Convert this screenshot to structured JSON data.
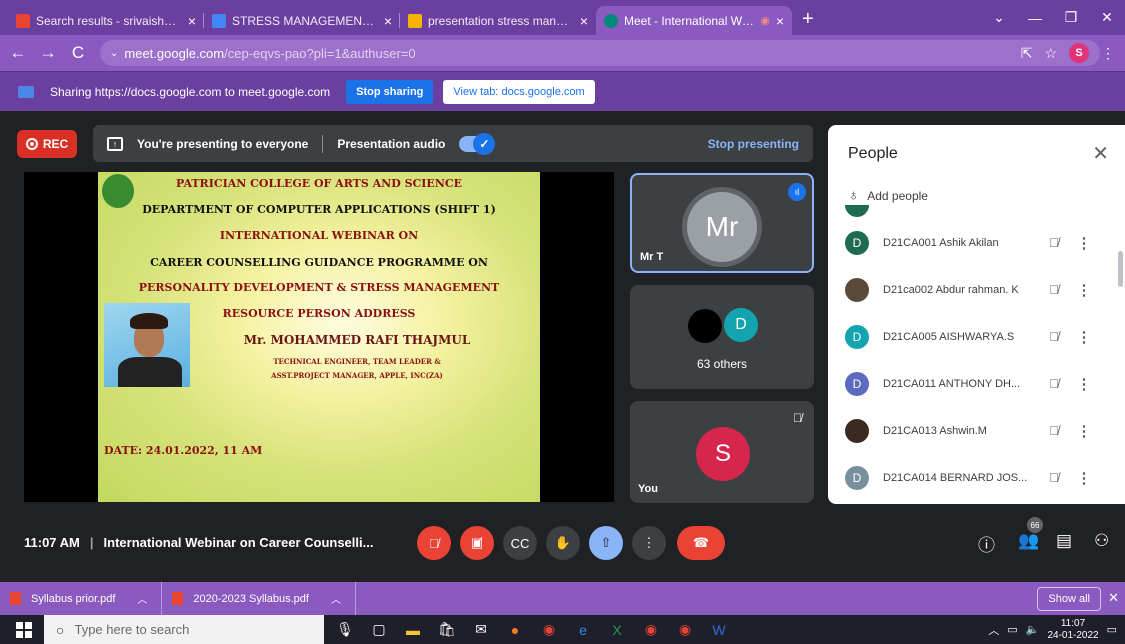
{
  "browser": {
    "tabs": [
      {
        "title": "Search results - srivaishnavi@pat",
        "icon": "gmail-icon",
        "color": "#ea4335"
      },
      {
        "title": "STRESS MANAGEMENT REPORT",
        "icon": "docs-icon",
        "color": "#4285f4"
      },
      {
        "title": "presentation stress mangem",
        "icon": "slides-icon",
        "color": "#f4b400"
      },
      {
        "title": "Meet - International Webina",
        "icon": "meet-icon",
        "color": "#00897b"
      }
    ],
    "url_host": "meet.google.com",
    "url_path": "/cep-eqvs-pao?pli=1&authuser=0",
    "profile_initial": "S"
  },
  "sharing": {
    "text": "Sharing https://docs.google.com to meet.google.com",
    "stop_label": "Stop sharing",
    "view_label": "View tab: docs.google.com"
  },
  "meet": {
    "rec_label": "REC",
    "presenting_text": "You're presenting to everyone",
    "audio_label": "Presentation audio",
    "stop_presenting": "Stop presenting",
    "slide": {
      "college": "PATRICIAN COLLEGE OF ARTS AND SCIENCE",
      "department": "DEPARTMENT OF COMPUTER APPLICATIONS (SHIFT 1)",
      "webinar": "INTERNATIONAL WEBINAR ON",
      "programme": "CAREER COUNSELLING GUIDANCE PROGRAMME ON",
      "topic": "PERSONALITY DEVELOPMENT & STRESS MANAGEMENT",
      "resource": "RESOURCE PERSON ADDRESS",
      "speaker": "Mr. MOHAMMED RAFI THAJMUL",
      "role1": "TECHNICAL ENGINEER, TEAM LEADER &",
      "role2": "ASST.PROJECT MANAGER, APPLE, INC(ZA)",
      "date": "DATE: 24.01.2022, 11 AM"
    },
    "tiles": [
      {
        "name": "Mr T",
        "initials": "Mr",
        "color": "#9aa0a6"
      },
      {
        "name": "63 others",
        "initials": "D",
        "color": "#12a4af"
      },
      {
        "name": "You",
        "initials": "S",
        "color": "#d7264c"
      }
    ],
    "time": "11:07 AM",
    "meeting_title": "International Webinar on Career Counselli...",
    "people_count": "66"
  },
  "people": {
    "title": "People",
    "add_label": "Add people",
    "list": [
      {
        "initial": "D",
        "name": "D21CA001 Ashik Akilan",
        "color": "#1e6b52",
        "photo": false
      },
      {
        "initial": "",
        "name": "D21ca002 Abdur rahman. K",
        "color": "#5a4a3a",
        "photo": true
      },
      {
        "initial": "D",
        "name": "D21CA005 AISHWARYA.S",
        "color": "#12a4af",
        "photo": false
      },
      {
        "initial": "D",
        "name": "D21CA011 ANTHONY DH...",
        "color": "#5c6bc0",
        "photo": false
      },
      {
        "initial": "",
        "name": "D21CA013 Ashwin.M",
        "color": "#3a2a20",
        "photo": true
      },
      {
        "initial": "D",
        "name": "D21CA014 BERNARD JOS...",
        "color": "#78909c",
        "photo": false
      }
    ]
  },
  "downloads": {
    "files": [
      "Syllabus prior.pdf",
      "2020-2023 Syllabus.pdf"
    ],
    "show_all": "Show all"
  },
  "taskbar": {
    "search_placeholder": "Type here to search",
    "clock_time": "11:07",
    "clock_date": "24-01-2022"
  }
}
